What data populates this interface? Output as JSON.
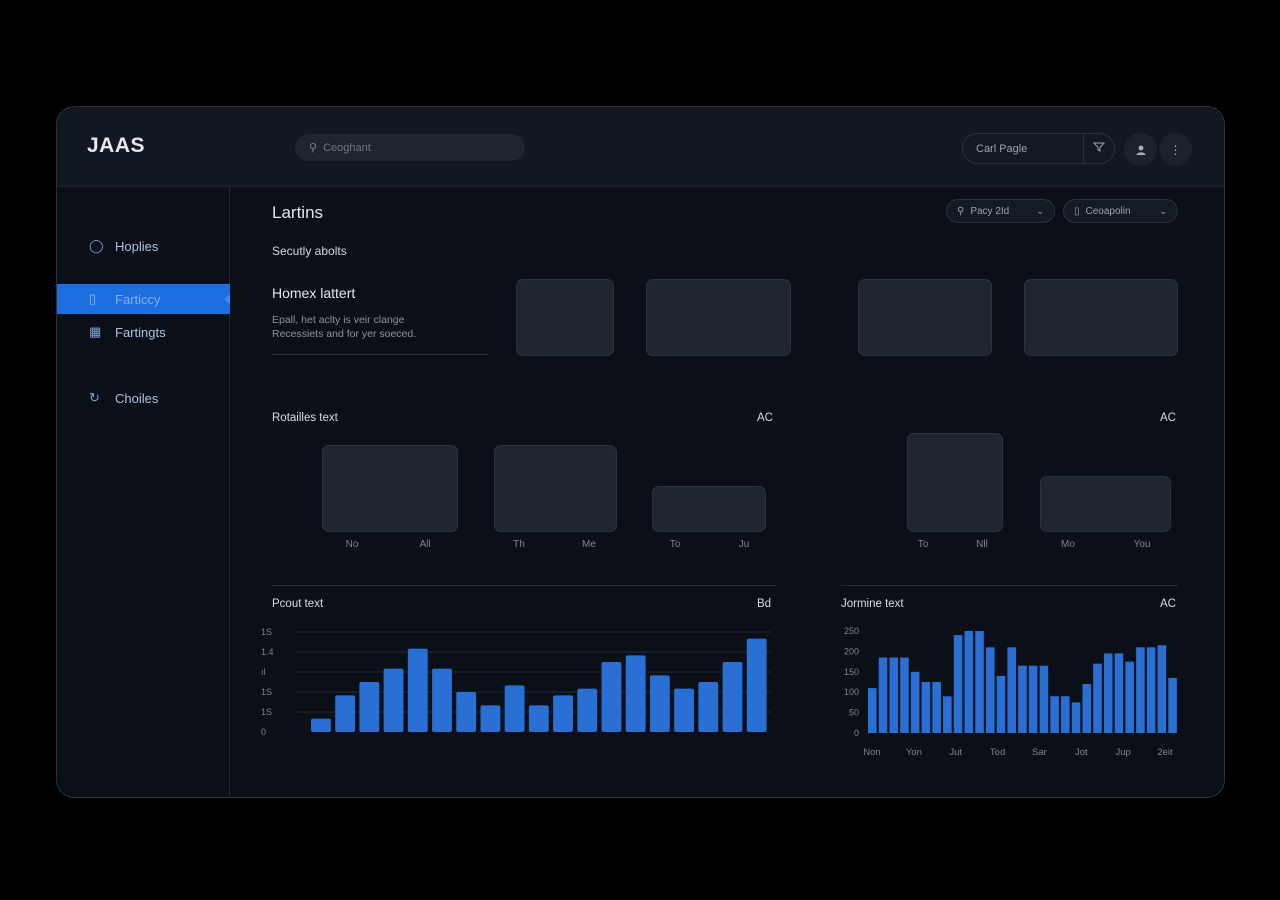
{
  "app": {
    "title": "JAAS"
  },
  "search": {
    "placeholder": "Ceoghant"
  },
  "topbar": {
    "page_button": "Carl Pagle"
  },
  "sidebar": {
    "items": [
      {
        "label": "Hoplies",
        "icon": "bulb-icon"
      },
      {
        "label": "Farticcy",
        "icon": "document-icon",
        "active": true
      },
      {
        "label": "Fartingts",
        "icon": "grid-icon"
      },
      {
        "label": "Choiles",
        "icon": "refresh-icon"
      }
    ]
  },
  "main": {
    "title": "Lartins",
    "subtitle": "Secutly abolts",
    "filter_1": "Pacy 2Id",
    "filter_2": "Ceoapolin",
    "intro": {
      "heading": "Homex lattert",
      "line1": "Epall, het aclty is veir clange",
      "line2": "Recessiets and for yer soeced."
    }
  },
  "panel_a": {
    "title": "Rotailles text",
    "badge": "AC",
    "labels": [
      "No",
      "All",
      "Th",
      "Me",
      "To",
      "Ju"
    ]
  },
  "panel_b": {
    "badge": "AC",
    "labels": [
      "To",
      "Nll",
      "Mo",
      "You"
    ]
  },
  "chart_left": {
    "title": "Pcout text",
    "badge": "Bd"
  },
  "chart_right": {
    "title": "Jormine text",
    "badge": "AC"
  },
  "colors": {
    "accent": "#1d6fe0",
    "bar": "#2a6fd3",
    "background": "#0b0f17"
  },
  "chart_data": [
    {
      "type": "bar",
      "title": "Pcout text",
      "y_ticks": [
        "0",
        "1S",
        "1S",
        "ıl",
        "1.4",
        "1S"
      ],
      "values": [
        4,
        11,
        15,
        19,
        25,
        19,
        12,
        8,
        14,
        8,
        11,
        13,
        21,
        23,
        17,
        13,
        15,
        21,
        28
      ]
    },
    {
      "type": "bar",
      "title": "Jormine text",
      "y_ticks": [
        "0",
        "50",
        "100",
        "150",
        "200",
        "250"
      ],
      "x_ticks": [
        "Non",
        "Yon",
        "Jut",
        "Tod",
        "Sar",
        "Jot",
        "Jup",
        "2eit"
      ],
      "values": [
        110,
        185,
        185,
        185,
        150,
        125,
        125,
        90,
        240,
        250,
        250,
        210,
        140,
        210,
        165,
        165,
        165,
        90,
        90,
        75,
        120,
        170,
        195,
        195,
        175,
        210,
        210,
        215,
        135
      ]
    }
  ]
}
